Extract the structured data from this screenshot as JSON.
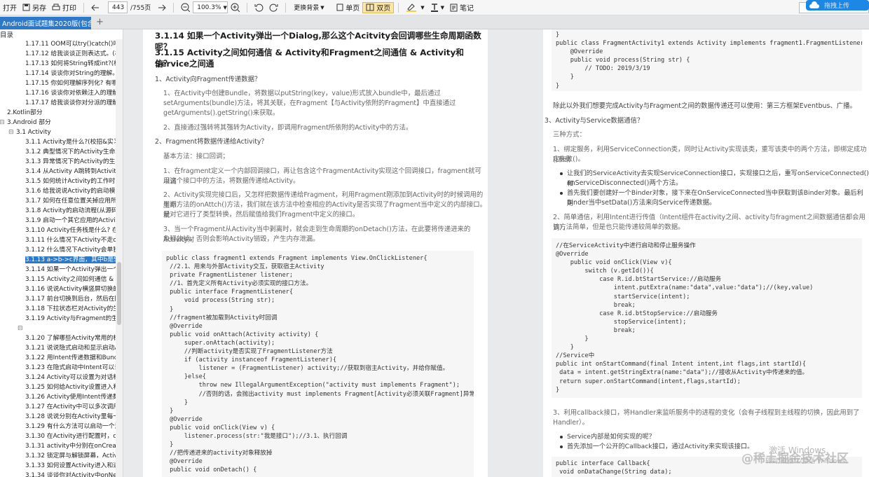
{
  "toolbar": {
    "open": "打开",
    "save_as": "另存",
    "print": "打印",
    "page_current": "443",
    "page_total": "/755页",
    "zoom": "100.3%",
    "background": "更换背景",
    "single": "单页",
    "double": "双页",
    "notes": "笔记",
    "upload": "拖拽上传"
  },
  "tab": {
    "title": "Android面试题集2020版(包含"
  },
  "sidebar": {
    "header": "目录",
    "items": [
      "1.17.11 OOM可以try()catch()吗?",
      "1.17.12 给我谈谈正则表达式。(校",
      "1.17.13 如何将String转成int?(校招",
      "1.17.14 谈谈你对String的理解。",
      "1.17.15 你如何理解序列化? 有哪些",
      "1.17.16 谈谈你对依赖注入的理解。",
      "1.17.17 给我谈谈你对分派的理解。",
      "2.Kotlin部分",
      "3.Android 部分",
      "3.1 Activity",
      "3.1.1 Activity是什么?(校招&实习",
      "3.1.2 典型情况下的Activity生命周",
      "3.1.3 异常情况下的Activity的生命",
      "3.1.4 从Activity A跳转到Activity B",
      "3.1.5 如何统计Activity的工作时间",
      "3.1.6 给我说说Activity的启动模式",
      "3.1.7 如何在任意位置关掉应用所有",
      "3.1.8 Activity的启动流程(从源码角",
      "3.1.9 启动一个其它应用的Activity",
      "3.1.10 Activity任务栈是什么? 在",
      "3.1.11 什么情况下Activity不走onD",
      "3.1.12 什么情况下Activity会单独执",
      "3.1.13 a->b->c界面，其中b是Sin",
      "3.1.14 如果一个Activity弹出一个D",
      "3.1.15 Activity之间如何通信 & Ac",
      "3.1.16 说说Activity横竖屏切换的生",
      "3.1.17 前台切换到后台，然后在回",
      "3.1.18 下拉状态栏对Activity的生命",
      "3.1.19 Activity与Fragment的生命",
      "",
      "3.1.20 了解哪些Activity常用的标记",
      "3.1.21 说说隐式启动和显示启动Ac",
      "3.1.22 用Intent传递数据和Bundle",
      "3.1.23 在隐式启动中Intent可以设",
      "3.1.24 Activity可以设置为对话框",
      "3.1.25 如何给Activity设置进入和退",
      "3.1.26 Activity使用Intent传递数据",
      "3.1.27 在Activity中可以多次调用s",
      "3.1.28 说说分别在Activity里每一个",
      "3.1.29 有什么方法可以启动一个没",
      "3.1.30 在Activity进行配置时，cat",
      "3.1.31 activity中分别在onCreate,",
      "3.1.32 锁定屏与解锁屏幕，Activit",
      "3.1.33 如何设置Activity进入和退出",
      "3.1.34 谈谈你对Activity中onNew"
    ]
  },
  "left_page": {
    "h1": "3.1.14 如果一个Activity弹出一个Dialog,那么这个Acitvity会回调哪些生命周期函数呢？",
    "h2a": "3.1.15 Activity之间如何通信 & Activity和Fragment之间通信 & Activity和Service之间通",
    "h2b": "信？",
    "s1": "1、Activity向Fragment传递数据？",
    "s1p1a": "1、在Activity中创建Bundle，将数据以putString(key，value)形式放入bundle中，最后通过",
    "s1p1b": "setArguments(bundle)方法，将其关联，在Fragment【与Activity依附的Fragment】中直接通过",
    "s1p1c": "getArguments().getString()来获取。",
    "s1p2": "2、直接通过强转将其强转为Activity，即调用Fragment所依附的Activity中的方法。",
    "s2": "2、Fragment将数据传递给Activity？",
    "s2p0": "基本方法：接口回调；",
    "s2p1a": "1、在fragment定义一个内部回调接口，再让包含这个FragmentActivity实现这个回调接口，fragment就可以调",
    "s2p1b": "用这个接口中的方法，将数据传递给Activity。",
    "s2p2a": "2、Activity实现完接口后，又怎样把数据传递给Fragment，利用Fragment刚添加到Activity时的时候调用的生命",
    "s2p2b": "周期方法的onAttch()方法，我们就在该方法中检查相应的Activity是否实现了Fragment当中定义的内部接口。就",
    "s2p2c": "是对它进行了类型转换，然后赋值给我们Fragment中定义的接口。",
    "s2p3a": "3、当一个Fragment从Activity当中剥离时，就会走到生命周期的onDetach()方法，在此要将传递进来的Activity对",
    "s2p3b": "象释放掉，否则会影响Activity销毁，产生内存泄漏。",
    "code": [
      "public class fragment1 extends Fragment implements View.OnClickListener{",
      " //2.1、用来与外部Activity交互，获取宿主Activity",
      " private FragmentListener listener;",
      " //1、首先定义所有Activity必须实现的接口方法。",
      " public interface FragmentListener{",
      "     void process(String str);",
      " }",
      " //fragment被加载到Activity时回调",
      " @Override",
      " public void onAttach(Activity activity) {",
      "     super.onAttach(activity);",
      "     //判断activity是否实现了FragmentListener方法",
      "     if (activity instanceof FragmentListener){",
      "         listener = (FragmentListener) activity;//获取到宿主Activity，并给你赋值。",
      "     }else{",
      "         throw new IllegalArgumentException(\"activity must implements Fragment\");",
      "         //否则的话，会抛出activity must implements Fragment[Activity必须关联Fragment]异常。",
      "     }",
      " }",
      " @Override",
      " public void onClick(View v) {",
      "     listener.process(str:\"我是接口\");//3.1、执行回调",
      " }",
      " //把传递进来的activity对象释放掉",
      " @Override",
      " public void onDetach() {"
    ]
  },
  "right_page": {
    "code1": [
      "}",
      "public class FragmentActivity1 extends Activity implements fragment1.FragmentListener {",
      "    @Override",
      "    public void process(String str) {",
      "        // TODO: 2019/3/19",
      "    }",
      "}"
    ],
    "p1": "除此以外我们想要完成Activity与Fragment之间的数据传递还可以使用：第三方框架Eventbus、广播。",
    "s3": "3、Activity与Service数据通信？",
    "s3p0": "三种方式：",
    "s3p1a": "1、绑定服务，利用ServiceConnection类，同时让Activity实现该类，重写该类中的两个方法，即绑定成功()和绑",
    "s3p1b": "定失败()。",
    "b1a": "让我们的ServiceActivity去实现ServiceConnection接口，实现接口之后，重写onServiceConnected()和",
    "b1b": "onServiceDisconnected()两个方法。",
    "b2a": "首先我们要创建好一个Binder对象，接下来在OnServiceConnected当中获取到该Binder对象。最后利用",
    "b2b": "Binder当中setData()方法来向Service传递数据。",
    "s3p2a": "2、简单通信，利用Intent进行传值（Intent组件在activity之间、activity与fragment之间数据通信都会用到），",
    "s3p2b": "该方法简单，但是也只能传递较简单的数据。",
    "code2": [
      "//在ServiceActivity中进行启动和停止服务操作",
      "@Override",
      "    public void onClick(View v){",
      "        switch (v.getId()){",
      "            case R.id.btStartService://启动服务",
      "                intent.putExtra(name:\"data\",value:\"data\");//(key,value)",
      "                startService(intent);",
      "                break;",
      "            case R.id.btStopService://启动服务",
      "                stopService(intent);",
      "                break;",
      "        }",
      "    }",
      "//Service中",
      "public int onStartCommand(final Intent intent,int flags,int startId){",
      " data = intent.getStringExtra(name:\"data\");//接收从Activity中传递来的值。",
      " return super.onStartCommand(intent,flags,startId);",
      "}"
    ],
    "s3p3a": "3、利用callback接口，将Handler来监听服务中的进程的变化（会有子线程到主线程的切换，因此用到了",
    "s3p3b": "Handler）。",
    "b3": "Service内部是如何实现的呢？",
    "b4": "首先添加一个公开的Callback接口，通过Activity来实现该接口。",
    "code3": [
      "public interface Callback{",
      " void onDataChange(String data);"
    ]
  },
  "watermark": {
    "w1": "激活 Windows",
    "w2": "转到\"设置\"以激活 Windows。",
    "brand": "@稀土掘金技术社区"
  }
}
